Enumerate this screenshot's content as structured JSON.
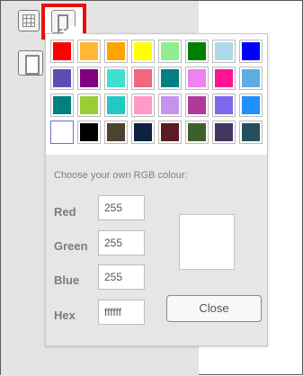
{
  "toolbar": {
    "tools": [
      {
        "icon": "grid-icon"
      },
      {
        "icon": "page-icon"
      },
      {
        "icon": "bookmark-shape-icon",
        "selected": true
      }
    ],
    "selection_highlight_color": "#e8110c"
  },
  "color_picker": {
    "swatches": [
      "#ff0000",
      "#ffb833",
      "#ffa500",
      "#ffff00",
      "#90ee90",
      "#008000",
      "#add8e6",
      "#0000ff",
      "#5c4db1",
      "#800080",
      "#40e0d0",
      "#f06780",
      "#008080",
      "#ee82ee",
      "#ff1493",
      "#5dade2",
      "#008080",
      "#9acd32",
      "#20c9c1",
      "#ff9ac8",
      "#c493f0",
      "#b03a9a",
      "#7b68ee",
      "#1e90ff",
      "#ffffff",
      "#000000",
      "#4d4230",
      "#0f2140",
      "#5c1a24",
      "#3f5f2a",
      "#433660",
      "#23505c"
    ],
    "selected_index": 24,
    "rgb_title": "Choose your own RGB colour:",
    "fields": {
      "red_label": "Red",
      "red_value": "255",
      "green_label": "Green",
      "green_value": "255",
      "blue_label": "Blue",
      "blue_value": "255",
      "hex_label": "Hex",
      "hex_value": "ffffff"
    },
    "preview_color": "#ffffff",
    "close_label": "Close"
  }
}
